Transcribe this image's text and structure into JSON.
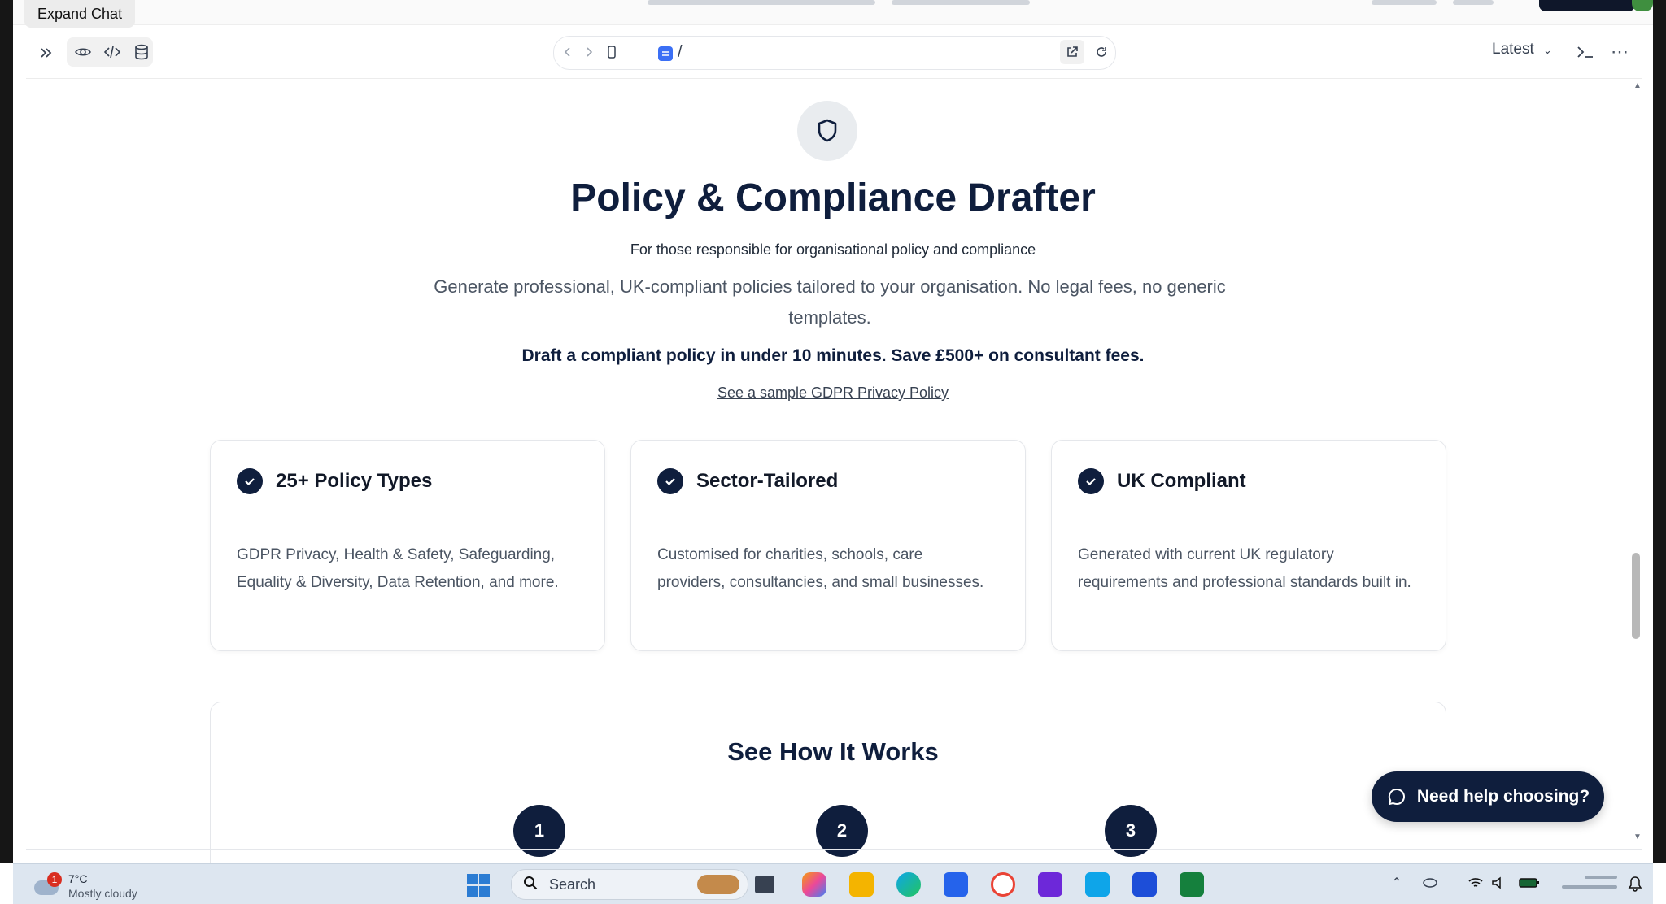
{
  "tooltip": "Expand Chat",
  "toolbar": {
    "url_path": "/",
    "version_label": "Latest"
  },
  "hero": {
    "title": "Policy & Compliance Drafter",
    "subtitle": "For those responsible for organisational policy and compliance",
    "description": "Generate professional, UK-compliant policies tailored to your organisation. No legal fees, no generic templates.",
    "value_prop": "Draft a compliant policy in under 10 minutes. Save £500+ on consultant fees.",
    "sample_link": "See a sample GDPR Privacy Policy"
  },
  "features": [
    {
      "title": "25+ Policy Types",
      "body": "GDPR Privacy, Health & Safety, Safeguarding, Equality & Diversity, Data Retention, and more."
    },
    {
      "title": "Sector-Tailored",
      "body": "Customised for charities, schools, care providers, consultancies, and small businesses."
    },
    {
      "title": "UK Compliant",
      "body": "Generated with current UK regulatory requirements and professional standards built in."
    }
  ],
  "how_it_works": {
    "title": "See How It Works",
    "steps": [
      "1",
      "2",
      "3"
    ]
  },
  "help_button": "Need help choosing?",
  "taskbar": {
    "weather_temp": "7°C",
    "weather_condition": "Mostly cloudy",
    "notification_count": "1",
    "search_label": "Search"
  },
  "colors": {
    "navy": "#0f1e3d",
    "accent_blue": "#3b6ff5"
  }
}
